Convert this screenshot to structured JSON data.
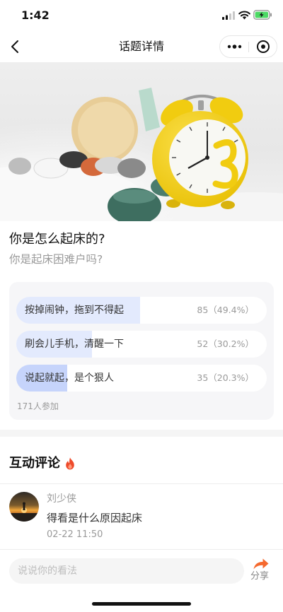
{
  "status_bar": {
    "time": "1:42",
    "icons": [
      "signal-icon",
      "wifi-icon",
      "battery-charging-icon"
    ]
  },
  "nav": {
    "title": "话题详情",
    "back_icon": "chevron-left-icon",
    "more_icon": "more-dots-icon",
    "close_icon": "target-circle-icon"
  },
  "topic": {
    "title": "你是怎么起床的?",
    "subtitle": "你是起床困难户吗?"
  },
  "poll": {
    "options": [
      {
        "label": "按掉闹钟，拖到不得起",
        "result": "85（49.4%）",
        "percent": 49.4,
        "selected": false
      },
      {
        "label": "刷会儿手机，清醒一下",
        "result": "52（30.2%）",
        "percent": 30.2,
        "selected": false
      },
      {
        "label": "说起就起，是个狠人",
        "result": "35（20.3%）",
        "percent": 20.3,
        "selected": true
      }
    ],
    "participants": "171人参加"
  },
  "comments": {
    "heading": "互动评论",
    "heading_icon": "fire-icon",
    "items": [
      {
        "author": "刘少侠",
        "text": "得看是什么原因起床",
        "time": "02-22 11:50"
      }
    ]
  },
  "footer": {
    "input_placeholder": "说说你的看法",
    "share_label": "分享",
    "share_icon": "share-arrow-icon"
  },
  "colors": {
    "option_fill": "#e3eafd",
    "selected_fill": "#c6d4fb",
    "share_orange": "#f5692e",
    "fire_red": "#ee4b2b",
    "battery_green": "#4cd964"
  }
}
